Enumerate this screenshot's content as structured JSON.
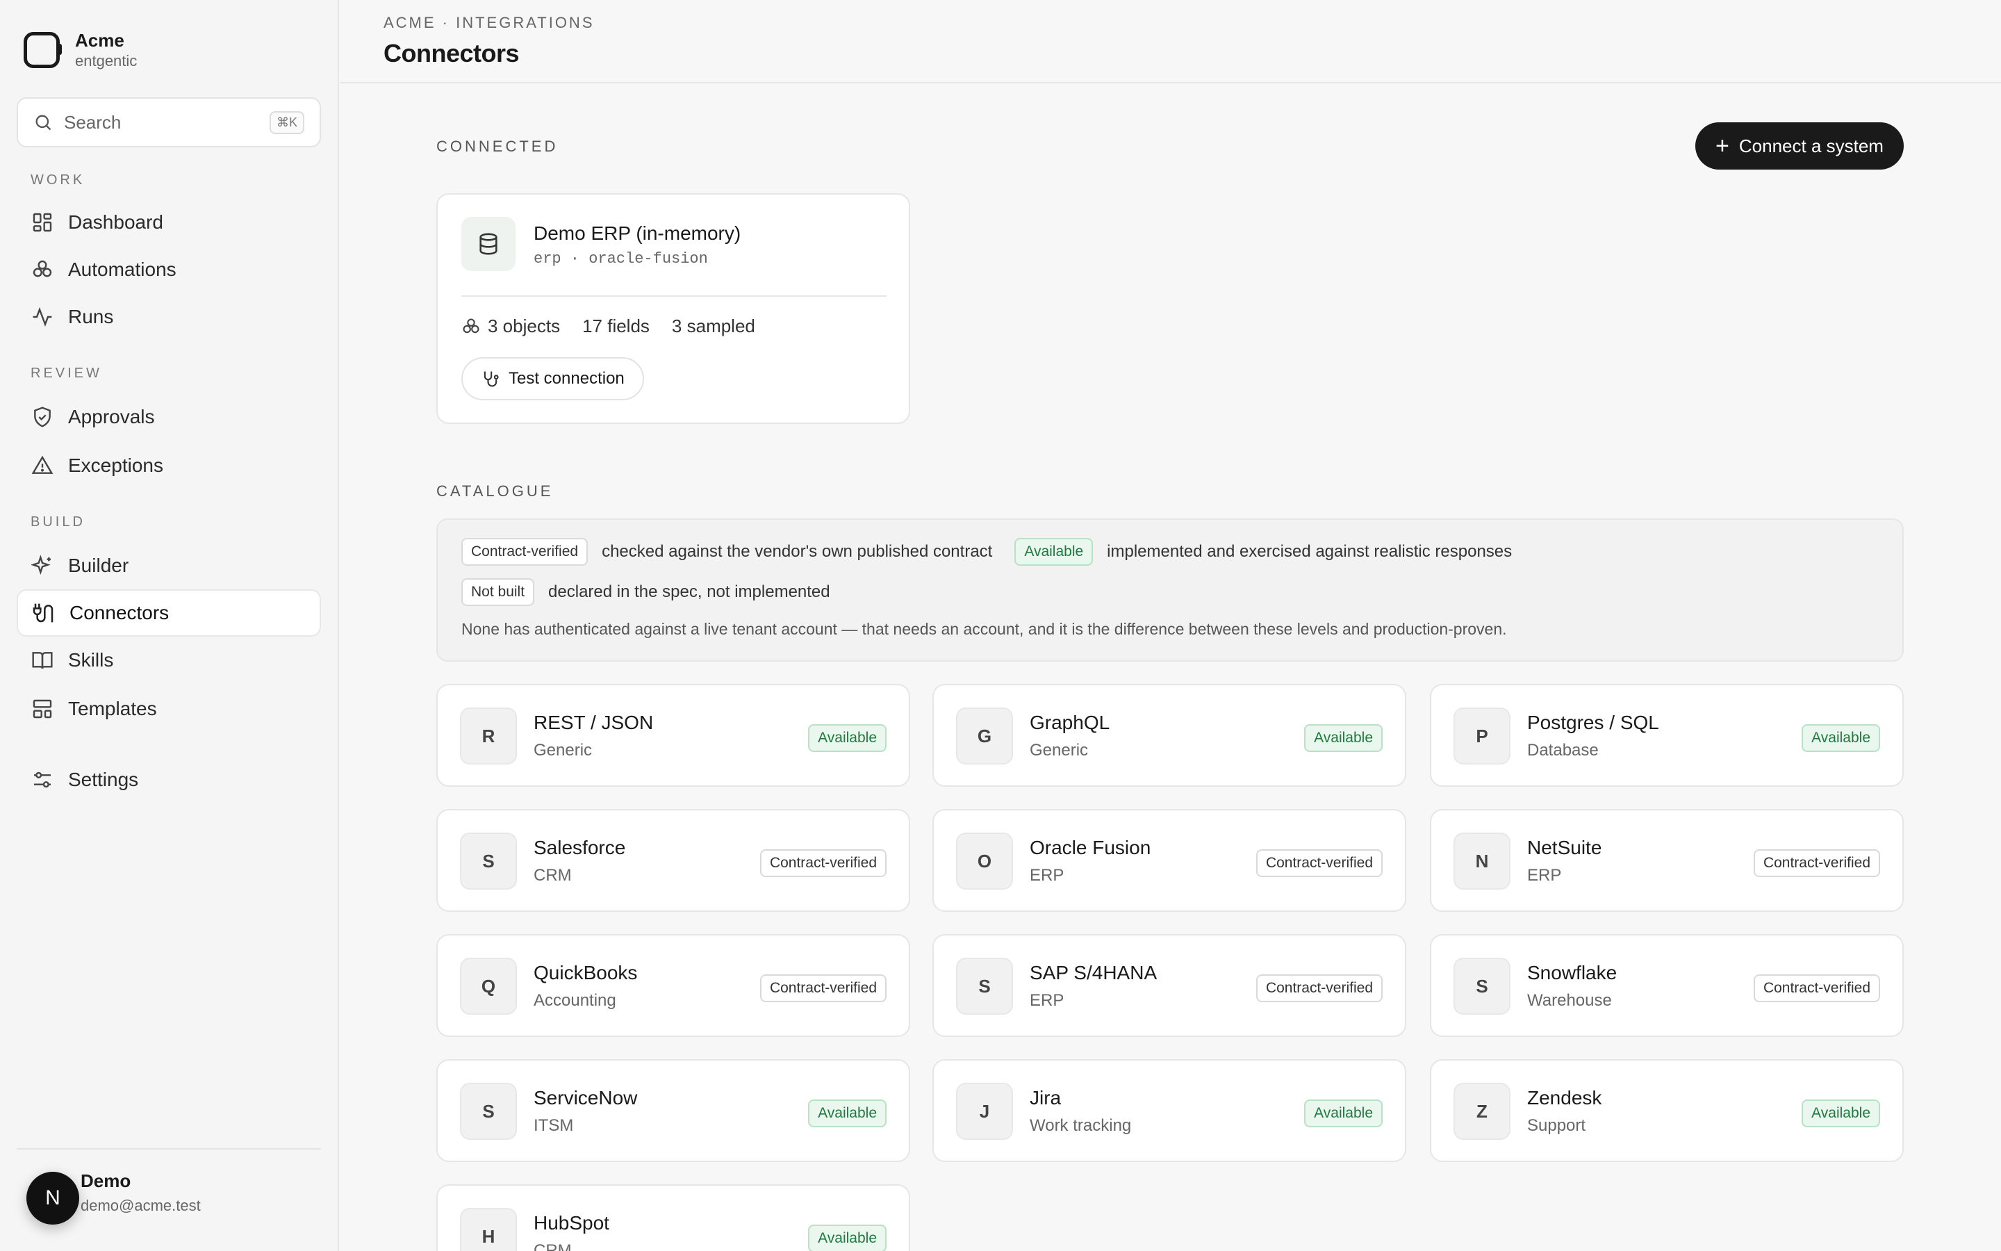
{
  "brand": {
    "name": "Acme",
    "sub": "entgentic"
  },
  "search": {
    "label": "Search",
    "shortcut": "⌘K"
  },
  "nav": {
    "sections": [
      "WORK",
      "REVIEW",
      "BUILD"
    ],
    "items": [
      {
        "label": "Dashboard",
        "icon": "grid-icon"
      },
      {
        "label": "Automations",
        "icon": "boxes-icon"
      },
      {
        "label": "Runs",
        "icon": "activity-icon"
      },
      {
        "label": "Approvals",
        "icon": "shield-check-icon"
      },
      {
        "label": "Exceptions",
        "icon": "alert-triangle-icon"
      },
      {
        "label": "Builder",
        "icon": "sparkles-icon"
      },
      {
        "label": "Connectors",
        "icon": "plug-icon",
        "active": true
      },
      {
        "label": "Skills",
        "icon": "book-icon"
      },
      {
        "label": "Templates",
        "icon": "layout-icon"
      },
      {
        "label": "Settings",
        "icon": "sliders-icon"
      }
    ]
  },
  "user": {
    "initial": "N",
    "name": "Demo",
    "email": "demo@acme.test"
  },
  "header": {
    "breadcrumb": "ACME · INTEGRATIONS",
    "title": "Connectors"
  },
  "connected": {
    "section_label": "CONNECTED",
    "connect_button": "Connect a system",
    "card": {
      "title": "Demo ERP (in-memory)",
      "subtitle": "erp · oracle-fusion",
      "stats": [
        "3 objects",
        "17 fields",
        "3 sampled"
      ],
      "test_button": "Test connection"
    }
  },
  "catalogue": {
    "section_label": "CATALOGUE",
    "legend": {
      "contract_badge": "Contract-verified",
      "contract_desc": "checked against the vendor's own published contract",
      "available_badge": "Available",
      "available_desc": "implemented and exercised against realistic responses",
      "notbuilt_badge": "Not built",
      "notbuilt_desc": "declared in the spec, not implemented",
      "note": "None has authenticated against a live tenant account — that needs an account, and it is the difference between these levels and production-proven."
    },
    "items": [
      {
        "letter": "R",
        "name": "REST / JSON",
        "category": "Generic",
        "status": "Available"
      },
      {
        "letter": "G",
        "name": "GraphQL",
        "category": "Generic",
        "status": "Available"
      },
      {
        "letter": "P",
        "name": "Postgres / SQL",
        "category": "Database",
        "status": "Available"
      },
      {
        "letter": "S",
        "name": "Salesforce",
        "category": "CRM",
        "status": "Contract-verified"
      },
      {
        "letter": "O",
        "name": "Oracle Fusion",
        "category": "ERP",
        "status": "Contract-verified"
      },
      {
        "letter": "N",
        "name": "NetSuite",
        "category": "ERP",
        "status": "Contract-verified"
      },
      {
        "letter": "Q",
        "name": "QuickBooks",
        "category": "Accounting",
        "status": "Contract-verified"
      },
      {
        "letter": "S",
        "name": "SAP S/4HANA",
        "category": "ERP",
        "status": "Contract-verified"
      },
      {
        "letter": "S",
        "name": "Snowflake",
        "category": "Warehouse",
        "status": "Contract-verified"
      },
      {
        "letter": "S",
        "name": "ServiceNow",
        "category": "ITSM",
        "status": "Available"
      },
      {
        "letter": "J",
        "name": "Jira",
        "category": "Work tracking",
        "status": "Available"
      },
      {
        "letter": "Z",
        "name": "Zendesk",
        "category": "Support",
        "status": "Available"
      },
      {
        "letter": "H",
        "name": "HubSpot",
        "category": "CRM",
        "status": "Available"
      }
    ]
  }
}
